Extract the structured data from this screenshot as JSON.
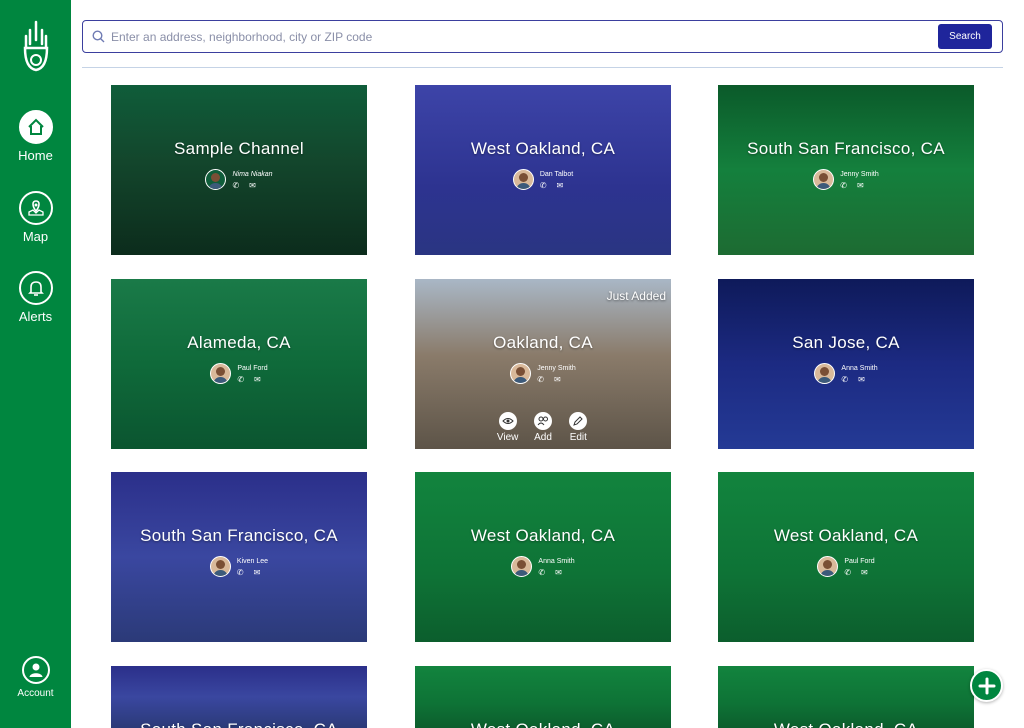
{
  "sidebar": {
    "nav": [
      {
        "label": "Home",
        "icon": "home-icon",
        "active": true
      },
      {
        "label": "Map",
        "icon": "map-icon",
        "active": false
      },
      {
        "label": "Alerts",
        "icon": "bell-icon",
        "active": false
      }
    ],
    "account_label": "Account"
  },
  "search": {
    "placeholder": "Enter an address, neighborhood, city or ZIP code",
    "button_label": "Search"
  },
  "colors": {
    "brand_green": "#00863f",
    "search_blue": "#1f259b"
  },
  "cards": [
    {
      "title": "Sample Channel",
      "agent": "Nima Niakan"
    },
    {
      "title": "West Oakland, CA",
      "agent": "Dan Talbot"
    },
    {
      "title": "South San Francisco, CA",
      "agent": "Jenny Smith"
    },
    {
      "title": "Alameda, CA",
      "agent": "Paul Ford"
    },
    {
      "title": "Oakland, CA",
      "agent": "Jenny Smith",
      "badge": "Just Added",
      "actions": [
        "View",
        "Add",
        "Edit"
      ]
    },
    {
      "title": "San Jose, CA",
      "agent": "Anna Smith"
    },
    {
      "title": "South San Francisco, CA",
      "agent": "Kiven Lee"
    },
    {
      "title": "West Oakland, CA",
      "agent": "Anna Smith"
    },
    {
      "title": "West Oakland, CA",
      "agent": "Paul Ford"
    },
    {
      "title": "South San Francisco, CA",
      "agent": ""
    },
    {
      "title": "West Oakland, CA",
      "agent": ""
    },
    {
      "title": "West Oakland, CA",
      "agent": ""
    }
  ]
}
